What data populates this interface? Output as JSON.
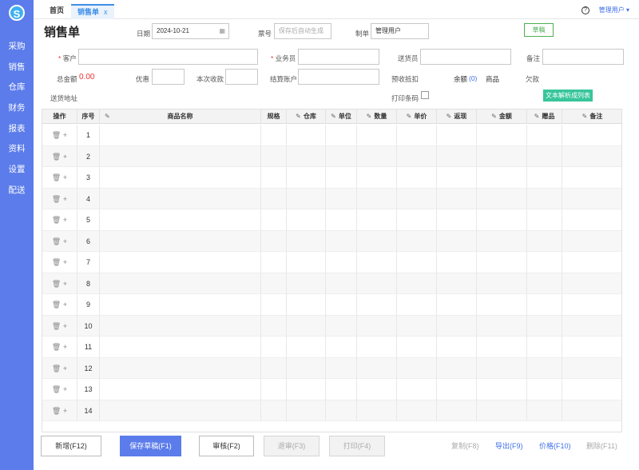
{
  "app": {
    "logo": "S"
  },
  "sidebar": {
    "items": [
      {
        "label": "采购"
      },
      {
        "label": "销售"
      },
      {
        "label": "仓库"
      },
      {
        "label": "财务"
      },
      {
        "label": "报表"
      },
      {
        "label": "资料"
      },
      {
        "label": "设置"
      },
      {
        "label": "配送"
      }
    ]
  },
  "topbar": {
    "tabs": [
      {
        "label": "首页"
      },
      {
        "label": "销售单",
        "close": "x"
      }
    ],
    "help": "?",
    "user": "管理用户 ▾"
  },
  "form": {
    "title": "销售单",
    "date_label": "日期",
    "date_value": "2024-10-21",
    "ticket_label": "票号",
    "ticket_placeholder": "保存后自动生成",
    "maker_label": "制单",
    "maker_value": "管理用户",
    "draft_badge": "草稿",
    "customer_label": "客户",
    "salesman_label": "业务员",
    "deliverer_label": "送货员",
    "note_label": "备注",
    "total_label": "总金额",
    "total_value": "0.00",
    "discount_label": "优惠",
    "received_label": "本次收款",
    "settle_account_label": "结算账户",
    "prepaid_label": "预收抵扣",
    "balance_label": "余额",
    "balance_value": "(0)",
    "goods_label": "商品",
    "debt_label": "欠款",
    "address_label": "送货地址",
    "print_barcode_label": "打印条码",
    "parse_button": "文本解析成列表",
    "required_mark": "*"
  },
  "table": {
    "columns": [
      "操作",
      "序号",
      "商品名称",
      "规格",
      "仓库",
      "单位",
      "数量",
      "单价",
      "返现",
      "金额",
      "赠品",
      "备注"
    ],
    "rows": [
      "1",
      "2",
      "3",
      "4",
      "5",
      "6",
      "7",
      "8",
      "9",
      "10",
      "11",
      "12",
      "13",
      "14"
    ],
    "row_icons": "🗑 +"
  },
  "footer": {
    "buttons": [
      "新增(F12)",
      "保存草稿(F1)",
      "审核(F2)",
      "退审(F3)",
      "打印(F4)"
    ],
    "links": [
      "复制(F8)",
      "导出(F9)",
      "价格(F10)",
      "删除(F11)"
    ]
  }
}
